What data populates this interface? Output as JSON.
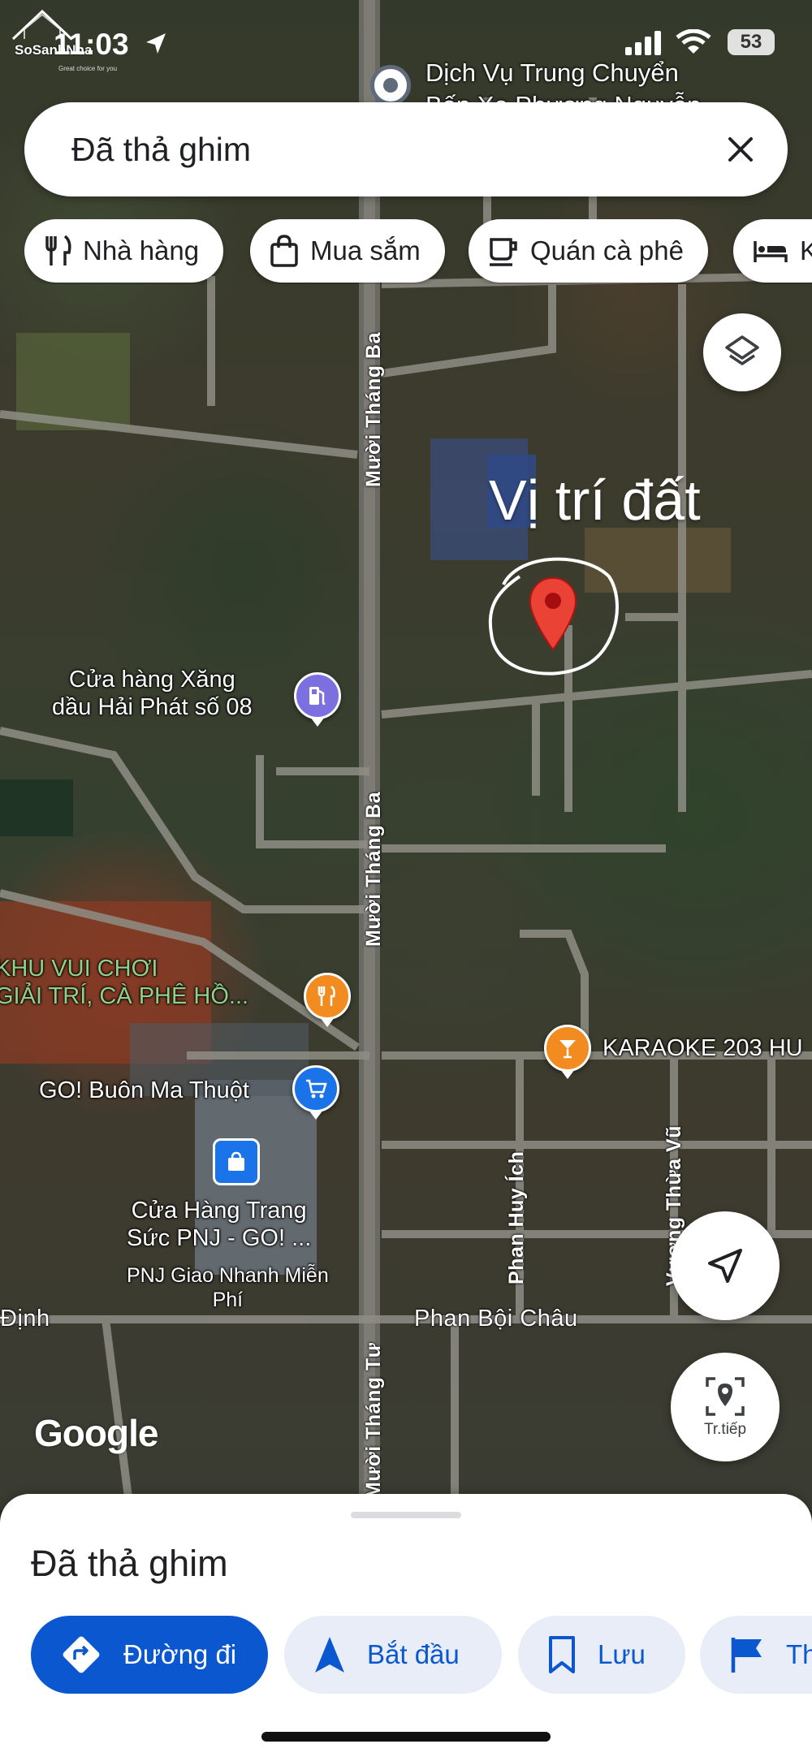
{
  "status_bar": {
    "time": "11:03",
    "battery": "53",
    "watermark_name": "SoSanhNha",
    "watermark_tagline": "Great choice for you"
  },
  "search": {
    "text": "Đã thả ghim"
  },
  "chips": [
    {
      "label": "Nhà hàng",
      "icon": "fork-knife-icon"
    },
    {
      "label": "Mua sắm",
      "icon": "shopping-bag-icon"
    },
    {
      "label": "Quán cà phê",
      "icon": "coffee-cup-icon"
    },
    {
      "label": "K",
      "icon": "bed-icon"
    }
  ],
  "map": {
    "top_poi": "Dịch Vụ Trung Chuyển\nBến Xe Phương Nguyễn",
    "annotation": "Vị trí đất",
    "roads": {
      "muoi_thang_ba_upper": "Mười Tháng Ba",
      "muoi_thang_ba_lower": "Mười Tháng Ba",
      "muoi_thang_tu": "Mười Tháng Tư",
      "phan_huy_ich": "Phan Huy Ích",
      "vuong_thua_vu": "Vương Thừa Vũ",
      "phan_boi_chau": "Phan Bội Châu",
      "dinh": "Định"
    },
    "pois": {
      "gas_station": "Cửa hàng Xăng\ndầu Hải Phát số 08",
      "amusement": "KHU VUI CHƠI\nGIẢI TRÍ, CÀ PHÊ HỒ...",
      "karaoke": "KARAOKE 203 HU",
      "go_store": "GO! Buôn Ma Thuột",
      "pnj": "Cửa Hàng Trang\nSức PNJ - GO! ...",
      "pnj_sub": "PNJ Giao Nhanh Miễn\nPhí"
    },
    "attribution": "Google",
    "live_view_label": "Tr.tiếp"
  },
  "sheet": {
    "title": "Đã thả ghim",
    "actions": [
      {
        "label": "Đường đi",
        "icon": "directions-icon",
        "primary": true
      },
      {
        "label": "Bắt đầu",
        "icon": "navigation-arrow-icon",
        "primary": false
      },
      {
        "label": "Lưu",
        "icon": "bookmark-icon",
        "primary": false
      },
      {
        "label": "Th",
        "icon": "flag-icon",
        "primary": false
      }
    ]
  },
  "colors": {
    "accent": "#0b57d0",
    "pin_red": "#ea4335",
    "poi_orange": "#f28b20",
    "poi_blue": "#1a73e8",
    "poi_gas": "#7c6fe0"
  }
}
